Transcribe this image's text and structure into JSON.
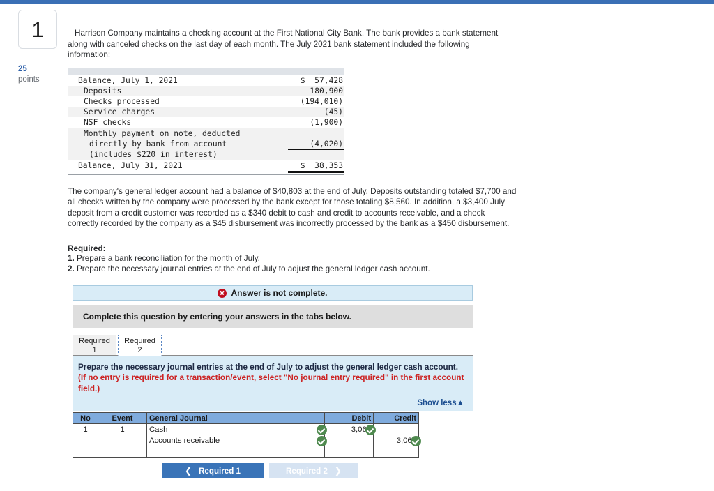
{
  "question": {
    "number": "1",
    "points_value": "25",
    "points_label": "points",
    "intro": "Harrison Company maintains a checking account at the First National City Bank. The bank provides a bank statement along with canceled checks on the last day of each month. The July 2021 bank statement included the following information:"
  },
  "statement": {
    "rows": [
      {
        "label": "Balance, July 1, 2021",
        "value": "$  57,428",
        "indent": 0
      },
      {
        "label": "Deposits",
        "value": "180,900",
        "indent": 1
      },
      {
        "label": "Checks processed",
        "value": "(194,010)",
        "indent": 1
      },
      {
        "label": "Service charges",
        "value": "(45)",
        "indent": 1
      },
      {
        "label": "NSF checks",
        "value": "(1,900)",
        "indent": 1
      },
      {
        "label": "Monthly payment on note, deducted",
        "value": "",
        "indent": 1
      },
      {
        "label": "directly by bank from account",
        "value": "(4,020)",
        "indent": 2
      },
      {
        "label": "(includes $220 in interest)",
        "value": "",
        "indent": 2
      },
      {
        "label": "Balance, July 31, 2021",
        "value": "$  38,353",
        "indent": 0
      }
    ]
  },
  "body": {
    "paragraph": "The company's general ledger account had a balance of $40,803 at the end of July. Deposits outstanding totaled $7,700 and all checks written by the company were processed by the bank except for those totaling $8,560. In addition, a $3,400 July deposit from a credit customer was recorded as a $340 debit to cash and credit to accounts receivable, and a check correctly recorded by the company as a $45 disbursement was incorrectly processed by the bank as a $450 disbursement.",
    "required_heading": "Required:",
    "req_1_num": "1.",
    "req_1_text": "Prepare a bank reconciliation for the month of July.",
    "req_2_num": "2.",
    "req_2_text": "Prepare the necessary journal entries at the end of July to adjust the general ledger cash account."
  },
  "panel": {
    "alert_text": "Answer is not complete.",
    "alert_icon": "error-circle-x-icon",
    "subbar_text": "Complete this question by entering your answers in the tabs below.",
    "tabs": [
      {
        "line1": "Required",
        "line2": "1",
        "active": false
      },
      {
        "line1": "Required",
        "line2": "2",
        "active": true
      }
    ],
    "question_text": "Prepare the necessary journal entries at the end of July to adjust the general ledger cash account.",
    "question_text_red": "(If no entry is required for a transaction/event, select \"No journal entry required\" in the first account field.)",
    "show_less_label": "Show less",
    "show_less_icon": "chevron-up-icon"
  },
  "journal_table": {
    "headers": [
      "No",
      "Event",
      "General Journal",
      "Debit",
      "Credit"
    ],
    "rows": [
      {
        "no": "1",
        "event": "1",
        "account": "Cash",
        "indent": false,
        "debit": "3,060",
        "credit": "",
        "account_check": true,
        "debit_check": true,
        "credit_check": false
      },
      {
        "no": "",
        "event": "",
        "account": "Accounts receivable",
        "indent": true,
        "debit": "",
        "credit": "3,060",
        "account_check": true,
        "debit_check": false,
        "credit_check": true
      },
      {
        "no": "",
        "event": "",
        "account": "",
        "indent": false,
        "debit": "",
        "credit": "",
        "account_check": false,
        "debit_check": false,
        "credit_check": false
      }
    ]
  },
  "nav": {
    "prev_label": "Required 1",
    "prev_icon": "chevron-left-icon",
    "next_label": "Required 2",
    "next_icon": "chevron-right-icon"
  },
  "colors": {
    "topbar": "#3a6fb5",
    "alert_bg": "#d9ecf7",
    "table_header": "#7fabdd",
    "check_green": "#4f8a4f",
    "error_red": "#c00d1e",
    "link_blue": "#1d4f91",
    "btn_primary": "#3a74b8",
    "btn_disabled": "#d6e3f2"
  }
}
